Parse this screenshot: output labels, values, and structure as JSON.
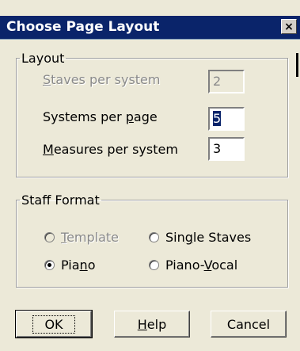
{
  "window": {
    "title": "Choose Page Layout",
    "close_glyph": "×"
  },
  "layout_group": {
    "legend": "Layout",
    "staves_per_system": {
      "label_mnemonic": "S",
      "label_rest": "taves per system",
      "value": "2",
      "enabled": false
    },
    "systems_per_page": {
      "label_pre": "Systems per ",
      "label_mnemonic": "p",
      "label_rest": "age",
      "value": "5"
    },
    "measures_per_system": {
      "label_mnemonic": "M",
      "label_rest": "easures per system",
      "value": "3"
    }
  },
  "staff_format_group": {
    "legend": "Staff Format",
    "template": {
      "label_mnemonic": "T",
      "label_rest": "emplate",
      "enabled": false,
      "checked": false
    },
    "single_staves": {
      "label_pre": "Sin",
      "label_mnemonic": "g",
      "label_rest": "le Staves",
      "checked": false
    },
    "piano": {
      "label_pre": "Pia",
      "label_mnemonic": "n",
      "label_rest": "o",
      "checked": true
    },
    "piano_vocal": {
      "label_pre": "Piano-",
      "label_mnemonic": "V",
      "label_rest": "ocal",
      "checked": false
    }
  },
  "buttons": {
    "ok": "OK",
    "help_mnemonic": "H",
    "help_rest": "elp",
    "cancel": "Cancel"
  }
}
